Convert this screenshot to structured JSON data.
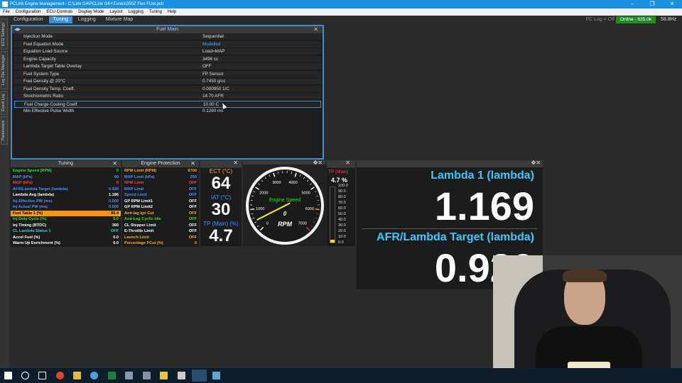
{
  "window": {
    "title": "PCLink Engine Management - C:\\Link G4\\PCLink G4+\\Tunes\\350Z Flex FUel.pclr"
  },
  "menu": [
    "File",
    "Configuration",
    "ECU Controls",
    "Display Mode",
    "Layout",
    "Logging",
    "Tuning",
    "Help"
  ],
  "tabs": [
    {
      "label": "Configuration"
    },
    {
      "label": "Tuning"
    },
    {
      "label": "Logging"
    },
    {
      "label": "Mixture Map"
    }
  ],
  "status": {
    "pclog": "PC Log = Off",
    "online": "Online - 625.0k",
    "rate": "58.8Hz"
  },
  "side_tabs": [
    "ECU Settings",
    "Log File Manager",
    "Event Log",
    "Parameters"
  ],
  "fuel_main": {
    "title": "Fuel Main",
    "rows": [
      {
        "k": "Injection Mode",
        "v": "Sequential"
      },
      {
        "k": "Fuel Equation Mode",
        "v": "Modelled"
      },
      {
        "k": "Equation Load Source",
        "v": "Load=MAP"
      },
      {
        "k": "Engine Capacity",
        "v": "3498 cc"
      },
      {
        "k": "Lambda Target Table Overlay",
        "v": "OFF"
      },
      {
        "k": "Fuel System Type",
        "v": "FP Sensor"
      },
      {
        "k": "Fuel Density @ 20°C",
        "v": "0.7450 g/cc"
      },
      {
        "k": "Fuel Density Temp. Coeff.",
        "v": "0.000950 1/C"
      },
      {
        "k": "Stoichiometric Ratio",
        "v": "14.70 AFR"
      },
      {
        "k": "Fuel Charge Cooling Coeff.",
        "v": "10.00 C"
      },
      {
        "k": "Min Effective Pulse Width",
        "v": "0.1280 ms"
      }
    ]
  },
  "tuning": {
    "title": "Tuning",
    "rows": [
      {
        "k": "Engine Speed (RPM)",
        "v": "0",
        "c": "g"
      },
      {
        "k": "MAP (kPa)",
        "v": "90",
        "c": "b"
      },
      {
        "k": "MGP (kPa)",
        "v": "0",
        "c": "r"
      },
      {
        "k": "AFR/Lambda Target (lambda)",
        "v": "0.920",
        "c": "b"
      },
      {
        "k": "Lambda Avg (lambda)",
        "v": "1.186",
        "c": "w"
      },
      {
        "k": "Inj Effective PW (ms)",
        "v": "0.000",
        "c": "b"
      },
      {
        "k": "Inj Actual PW (ms)",
        "v": "0.000",
        "c": "b"
      },
      {
        "k": "Fuel Table 1 (%)",
        "v": "86.4",
        "c": "hl"
      },
      {
        "k": "Inj Duty Cycle (%)",
        "v": "0.0",
        "c": "g"
      },
      {
        "k": "Inj Timing (BTDC)",
        "v": "360",
        "c": "w"
      },
      {
        "k": "CL Lambda Status 1",
        "v": "OFF",
        "c": "c"
      },
      {
        "k": "Accel Fuel (%)",
        "v": "0.0",
        "c": "w"
      },
      {
        "k": "Warm Up Enrichment (%)",
        "v": "0.0",
        "c": "w"
      }
    ]
  },
  "protection": {
    "title": "Engine Protection",
    "rows": [
      {
        "k": "RPM Limit (RPM)",
        "v": "6700",
        "c": "o"
      },
      {
        "k": "MAP Limit (kPa)",
        "v": "250",
        "c": "b"
      },
      {
        "k": "RPM Limit",
        "v": "OFF",
        "c": "r"
      },
      {
        "k": "MAP Limit",
        "v": "OFF",
        "c": "b"
      },
      {
        "k": "Speed Limit",
        "v": "OFF",
        "c": "b"
      },
      {
        "k": "GP RPM Limit1",
        "v": "OFF",
        "c": "w"
      },
      {
        "k": "GP RPM Limit2",
        "v": "OFF",
        "c": "w"
      },
      {
        "k": "Anti-lag Ign Cut",
        "v": "OFF",
        "c": "o"
      },
      {
        "k": "Anti-Lag Cyclic Idle",
        "v": "OFF",
        "c": "g"
      },
      {
        "k": "CL Stepper Limit",
        "v": "OFF",
        "c": "w"
      },
      {
        "k": "E-Throttle Limit",
        "v": "OFF",
        "c": "w"
      },
      {
        "k": "Launch Limit",
        "v": "OFF",
        "c": "o"
      },
      {
        "k": "Percentage FCut (%)",
        "v": "0",
        "c": "o"
      }
    ]
  },
  "gauges": {
    "ect_label": "ECT (°C)",
    "ect": "64",
    "iat_label": "IAT (°C)",
    "iat": "30",
    "tp_label": "TP (Main) (%)",
    "tp": "4.7",
    "rpm_title": "Engine Speed",
    "rpm_value": "0",
    "rpm_unit": "RPM",
    "rpm_ticks": [
      "0",
      "1000",
      "2000",
      "3000",
      "4000",
      "5000",
      "6000",
      "7000"
    ],
    "rpm_fraction": 0.0,
    "tpbar_label": "TP (Main)",
    "tpbar_value": "4.7 %",
    "tpbar_ticks": [
      "100.0",
      "90.0",
      "80.0",
      "70.0",
      "60.0",
      "50.0",
      "40.0",
      "30.0",
      "20.0",
      "10.0",
      "0.0"
    ],
    "tpbar_fraction": 0.047
  },
  "big": {
    "lambda_label": "Lambda 1 (lambda)",
    "lambda_value": "1.169",
    "target_label": "AFR/Lambda Target (lambda)",
    "target_value": "0.920"
  },
  "colors": {
    "accent": "#3a8fd8",
    "online": "#1f8f22",
    "highlight": "#ff9800"
  }
}
